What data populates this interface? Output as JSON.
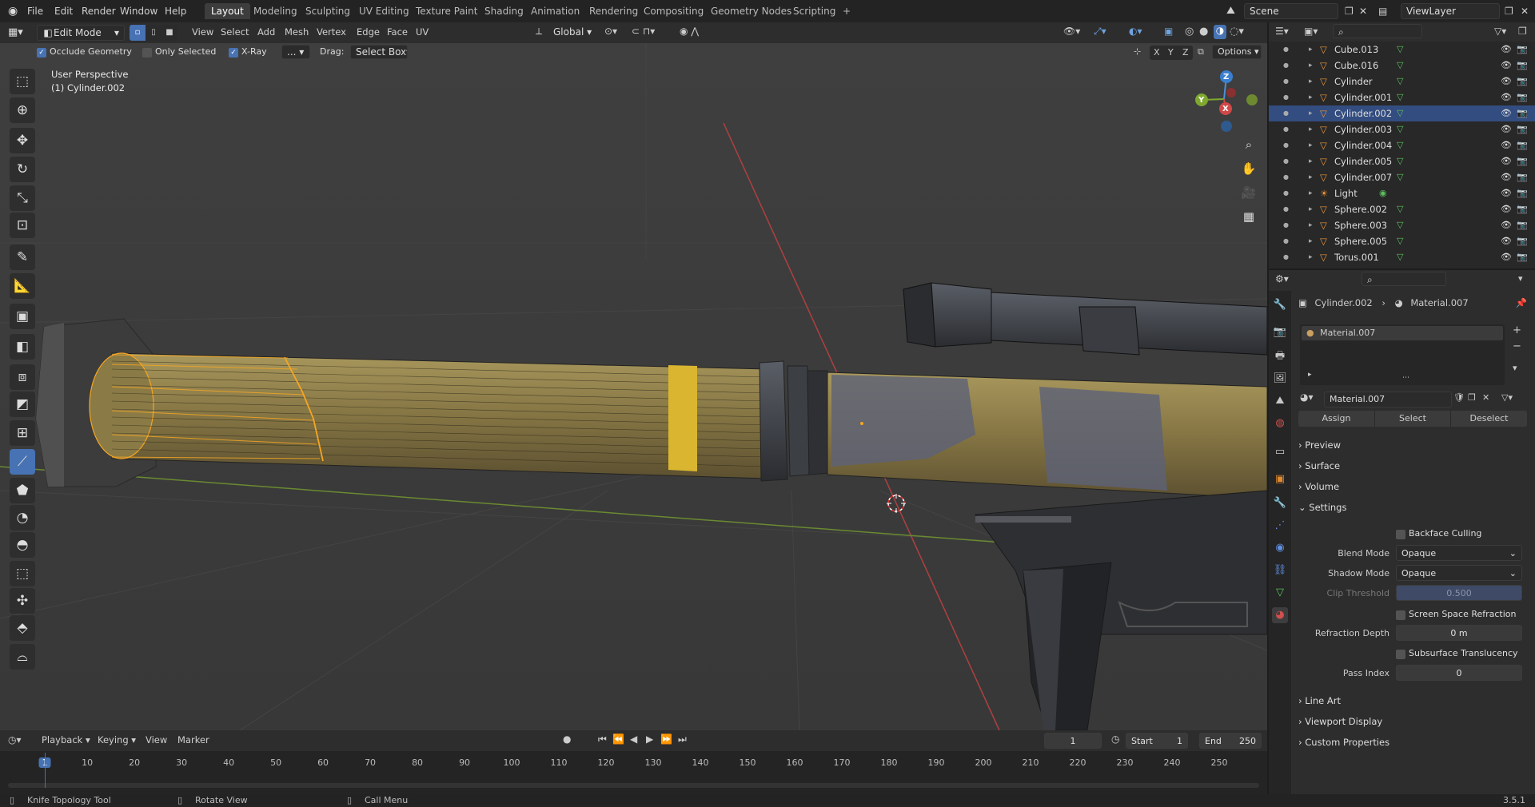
{
  "topbar": {
    "menus": [
      "File",
      "Edit",
      "Render",
      "Window",
      "Help"
    ],
    "workspaces": [
      "Layout",
      "Modeling",
      "Sculpting",
      "UV Editing",
      "Texture Paint",
      "Shading",
      "Animation",
      "Rendering",
      "Compositing",
      "Geometry Nodes",
      "Scripting"
    ],
    "active_workspace": "Layout",
    "add_tab": "+",
    "scene": "Scene",
    "view_layer": "ViewLayer"
  },
  "viewport_header": {
    "mode": "Edit Mode",
    "menus": [
      "View",
      "Select",
      "Add",
      "Mesh",
      "Vertex",
      "Edge",
      "Face",
      "UV"
    ],
    "orientation": "Global",
    "options_label": "Options",
    "axes": [
      "X",
      "Y",
      "Z"
    ]
  },
  "viewport_subheader": {
    "occlude_geometry": "Occlude Geometry",
    "only_selected": "Only Selected",
    "xray": "X-Ray",
    "dots": "...",
    "drag_label": "Drag:",
    "drag_value": "Select Box"
  },
  "viewport": {
    "perspective": "User Perspective",
    "object": "(1) Cylinder.002",
    "gizmo_axes": [
      "X",
      "Y",
      "Z"
    ]
  },
  "tools": [
    "select-box",
    "cursor",
    "move",
    "rotate",
    "scale",
    "transform",
    "annotate",
    "measure",
    "add-cube",
    "extrude",
    "inset",
    "bevel",
    "loop-cut",
    "knife",
    "poly-build",
    "spin",
    "smooth",
    "shrink-fatten",
    "shear",
    "rip"
  ],
  "outliner": {
    "items": [
      {
        "name": "Cube.013",
        "selected": false
      },
      {
        "name": "Cube.016",
        "selected": false
      },
      {
        "name": "Cylinder",
        "selected": false
      },
      {
        "name": "Cylinder.001",
        "selected": false
      },
      {
        "name": "Cylinder.002",
        "selected": true
      },
      {
        "name": "Cylinder.003",
        "selected": false
      },
      {
        "name": "Cylinder.004",
        "selected": false
      },
      {
        "name": "Cylinder.005",
        "selected": false
      },
      {
        "name": "Cylinder.007",
        "selected": false
      },
      {
        "name": "Light",
        "selected": false
      },
      {
        "name": "Sphere.002",
        "selected": false
      },
      {
        "name": "Sphere.003",
        "selected": false
      },
      {
        "name": "Sphere.005",
        "selected": false
      },
      {
        "name": "Torus.001",
        "selected": false
      }
    ]
  },
  "properties": {
    "breadcrumb_object": "Cylinder.002",
    "breadcrumb_material": "Material.007",
    "slot_name": "Material.007",
    "material_name": "Material.007",
    "assign": "Assign",
    "select": "Select",
    "deselect": "Deselect",
    "panels": {
      "preview": "Preview",
      "surface": "Surface",
      "volume": "Volume",
      "settings": "Settings",
      "line_art": "Line Art",
      "viewport_display": "Viewport Display",
      "custom_properties": "Custom Properties"
    },
    "settings": {
      "backface_culling": "Backface Culling",
      "blend_mode_label": "Blend Mode",
      "blend_mode": "Opaque",
      "shadow_mode_label": "Shadow Mode",
      "shadow_mode": "Opaque",
      "clip_threshold_label": "Clip Threshold",
      "clip_threshold": "0.500",
      "ssr": "Screen Space Refraction",
      "refraction_depth_label": "Refraction Depth",
      "refraction_depth": "0 m",
      "subsurface": "Subsurface Translucency",
      "pass_index_label": "Pass Index",
      "pass_index": "0"
    }
  },
  "timeline": {
    "menus": [
      "Playback",
      "Keying",
      "View",
      "Marker"
    ],
    "current_frame": "1",
    "start_label": "Start",
    "start": "1",
    "end_label": "End",
    "end": "250",
    "ticks": [
      "1",
      "10",
      "20",
      "30",
      "40",
      "50",
      "60",
      "70",
      "80",
      "90",
      "100",
      "110",
      "120",
      "130",
      "140",
      "150",
      "160",
      "170",
      "180",
      "190",
      "200",
      "210",
      "220",
      "230",
      "240",
      "250"
    ]
  },
  "statusbar": {
    "left": "Knife Topology Tool",
    "middle": "Rotate View",
    "right": "Call Menu",
    "version": "3.5.1"
  },
  "colors": {
    "accent": "#4772b3",
    "selection_orange": "#f5a623",
    "band_yellow": "#d9b530",
    "barrel": "#8c7a45"
  }
}
